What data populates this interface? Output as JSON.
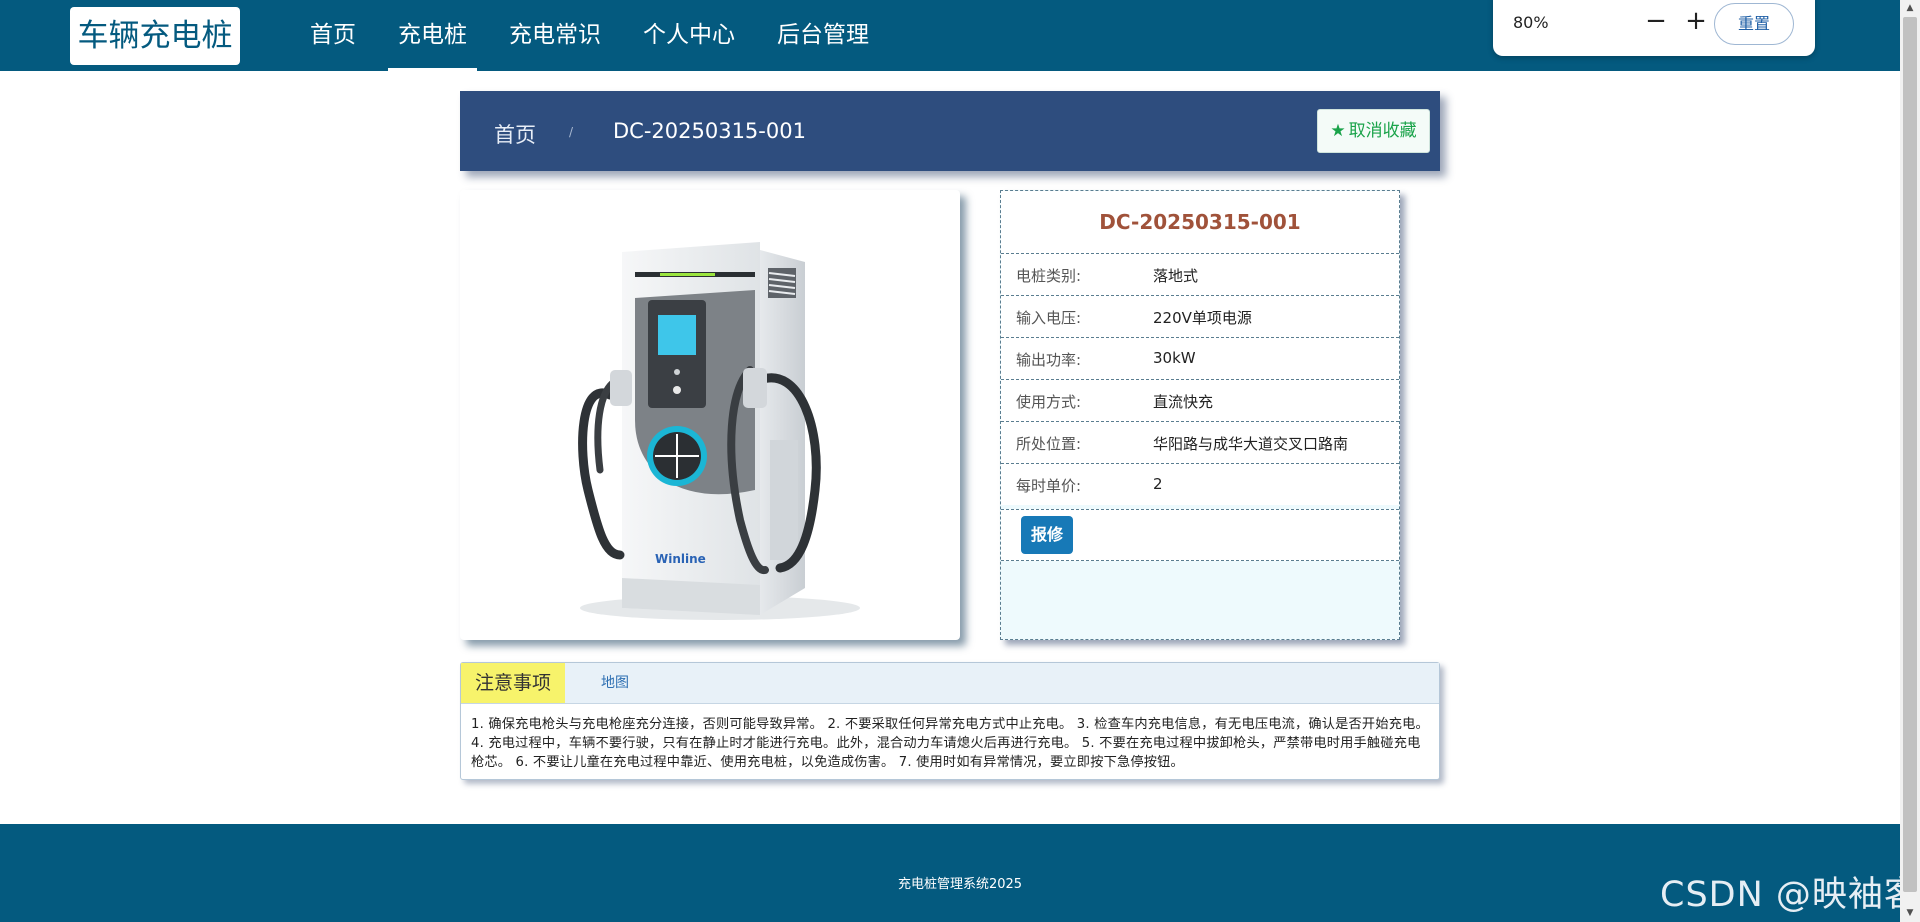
{
  "header": {
    "logo": "车辆充电桩",
    "nav": [
      {
        "label": "首页",
        "active": false
      },
      {
        "label": "充电桩",
        "active": true
      },
      {
        "label": "充电常识",
        "active": false
      },
      {
        "label": "个人中心",
        "active": false
      },
      {
        "label": "后台管理",
        "active": false
      }
    ]
  },
  "zoom": {
    "value": "80%",
    "zoom_out": "−",
    "zoom_in": "+",
    "reset_label": "重置"
  },
  "breadcrumb": {
    "home": "首页",
    "separator": "/",
    "current": "DC-20250315-001",
    "favorite_label": "取消收藏",
    "favorite_icon": "star-icon"
  },
  "product": {
    "title": "DC-20250315-001",
    "brand_mark": "Winline",
    "fields": [
      {
        "label": "电桩类别:",
        "value": "落地式"
      },
      {
        "label": "输入电压:",
        "value": "220V单项电源"
      },
      {
        "label": "输出功率:",
        "value": "30kW"
      },
      {
        "label": "使用方式:",
        "value": "直流快充"
      },
      {
        "label": "所处位置:",
        "value": "华阳路与成华大道交叉口路南"
      },
      {
        "label": "每时单价:",
        "value": "2"
      }
    ],
    "repair_label": "报修"
  },
  "tabs": {
    "notice_label": "注意事项",
    "map_label": "地图",
    "notice_text": "1. 确保充电枪头与充电枪座充分连接，否则可能导致异常。 2. 不要采取任何异常充电方式中止充电。 3. 检查车内充电信息，有无电压电流，确认是否开始充电。 4. 充电过程中，车辆不要行驶，只有在静止时才能进行充电。此外，混合动力车请熄火后再进行充电。 5. 不要在充电过程中拔卸枪头，严禁带电时用手触碰充电枪芯。 6. 不要让儿童在充电过程中靠近、使用充电桩，以免造成伤害。 7. 使用时如有异常情况，要立即按下急停按钮。"
  },
  "footer": {
    "text": "充电桩管理系统2025",
    "watermark": "CSDN @映袖客"
  },
  "scrollbar": {
    "up_icon": "▲",
    "down_icon": "▼"
  },
  "colors": {
    "primary": "#045a7f",
    "breadcrumb_bg": "#2e4d7e",
    "title_color": "#a0523a",
    "favorite_green": "#1aa34a",
    "repair_blue": "#1779b7",
    "notice_tab": "#f7f36b"
  }
}
